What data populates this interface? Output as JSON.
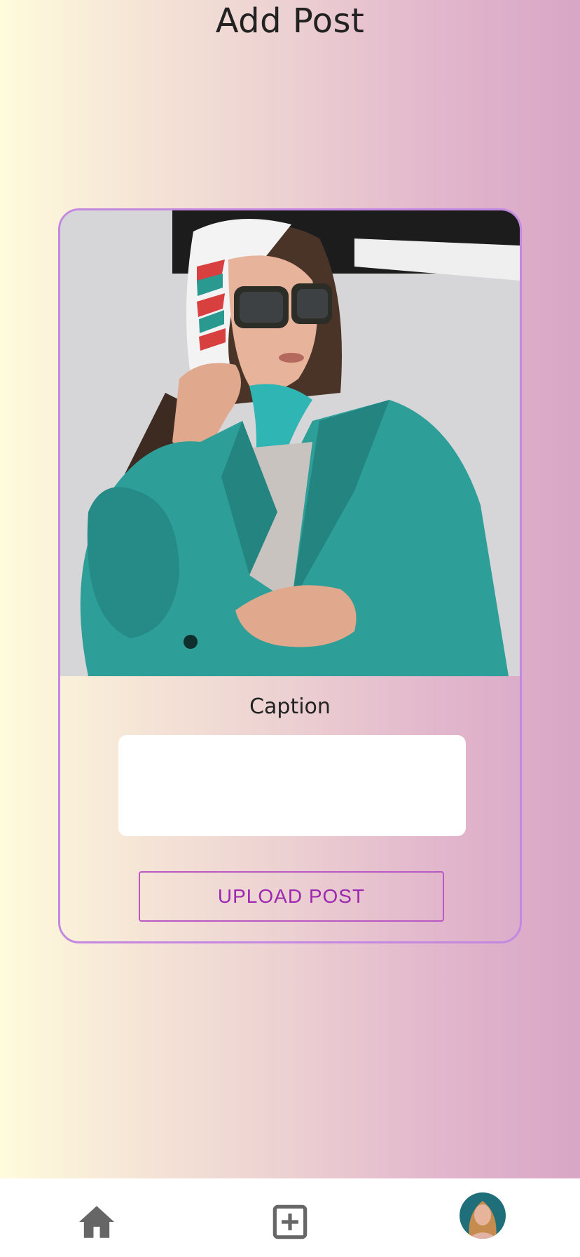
{
  "header": {
    "title": "Add Post"
  },
  "post_form": {
    "caption_label": "Caption",
    "caption_value": "",
    "upload_label": "UPLOAD POST"
  },
  "bottom_nav": {
    "items": [
      {
        "icon": "home-icon"
      },
      {
        "icon": "add-box-icon"
      },
      {
        "icon": "profile-avatar"
      }
    ]
  },
  "colors": {
    "gradient_start": "#fffbdc",
    "gradient_end": "#d8a6c6",
    "card_border": "#c488e0",
    "upload_text": "#9c27b0",
    "nav_icon": "#666666"
  }
}
